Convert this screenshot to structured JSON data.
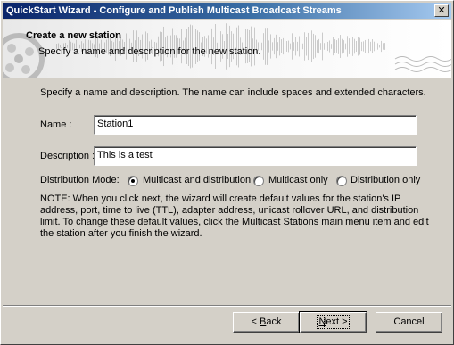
{
  "window": {
    "title": "QuickStart Wizard - Configure and Publish Multicast Broadcast Streams",
    "close_glyph": "✕"
  },
  "banner": {
    "title": "Create a new station",
    "subtitle": "Specify a name and description for the new station.",
    "graphic": "film-reel-waveform-icon"
  },
  "intro_text": "Specify a name and description.  The name can include spaces and extended characters.",
  "name_field": {
    "label": "Name :",
    "value": "Station1"
  },
  "description_field": {
    "label": "Description :",
    "value": "This is a test"
  },
  "distribution": {
    "label": "Distribution Mode:",
    "options": [
      {
        "label": "Multicast and distribution",
        "selected": true
      },
      {
        "label": "Multicast only",
        "selected": false
      },
      {
        "label": "Distribution only",
        "selected": false
      }
    ]
  },
  "note": "NOTE: When you click next, the wizard will create default values for the station's IP address, port, time to live (TTL), adapter address, unicast rollover URL, and distribution limit.  To change these default values, click the Multicast Stations main menu item and edit the station after you finish the wizard.",
  "buttons": {
    "back": {
      "prefix": "< ",
      "mnemonic": "B",
      "rest": "ack"
    },
    "next": {
      "mnemonic": "N",
      "rest": "ext >"
    },
    "cancel": "Cancel"
  }
}
